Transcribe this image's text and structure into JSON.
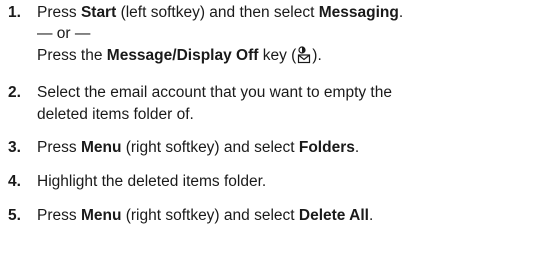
{
  "steps": [
    {
      "number": "1.",
      "line1_before": "Press ",
      "line1_bold1": "Start",
      "line1_mid": " (left softkey) and then select ",
      "line1_bold2": "Messaging",
      "line1_end": ".",
      "or_text": "— or —",
      "line3_before": "Press the ",
      "line3_bold": "Message/Display Off",
      "line3_mid": " key (",
      "line3_end": ").",
      "key_icon": "message-display-off-key-icon"
    },
    {
      "number": "2.",
      "line1": "Select the email account that you want to empty the",
      "line2": "deleted items folder of."
    },
    {
      "number": "3.",
      "before": "Press ",
      "bold1": "Menu",
      "mid": " (right softkey) and select ",
      "bold2": "Folders",
      "end": "."
    },
    {
      "number": "4.",
      "text": "Highlight the deleted items folder."
    },
    {
      "number": "5.",
      "before": "Press ",
      "bold1": "Menu",
      "mid": " (right softkey) and select ",
      "bold2": "Delete All",
      "end": "."
    }
  ]
}
